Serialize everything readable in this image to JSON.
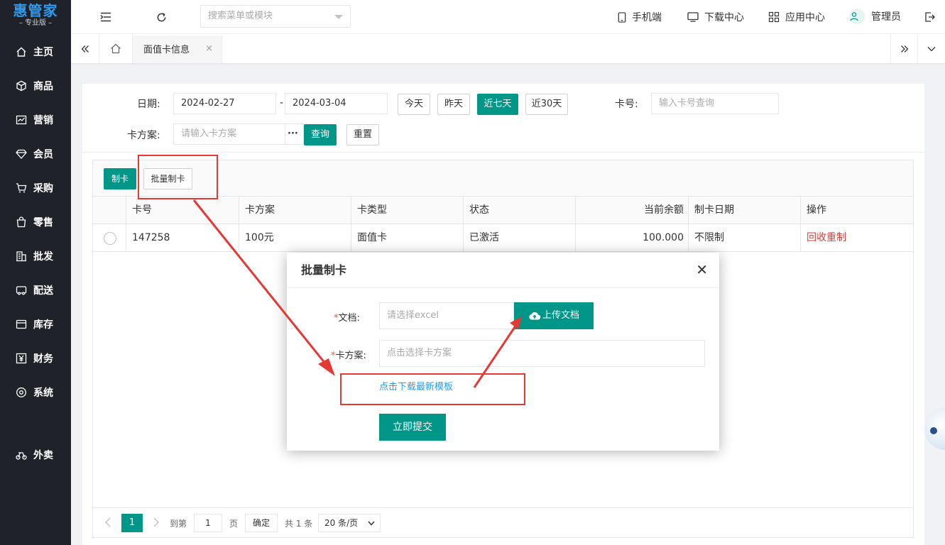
{
  "sidebar": {
    "logo": "惠管家",
    "logo_sub": "– 专业版 –",
    "items": [
      {
        "label": "主页",
        "icon": "home-icon"
      },
      {
        "label": "商品",
        "icon": "box-icon"
      },
      {
        "label": "营销",
        "icon": "chart-icon"
      },
      {
        "label": "会员",
        "icon": "diamond-icon"
      },
      {
        "label": "采购",
        "icon": "cart-icon"
      },
      {
        "label": "零售",
        "icon": "bag-icon"
      },
      {
        "label": "批发",
        "icon": "building-icon"
      },
      {
        "label": "配送",
        "icon": "truck-icon"
      },
      {
        "label": "库存",
        "icon": "inventory-icon"
      },
      {
        "label": "财务",
        "icon": "yen-icon"
      },
      {
        "label": "系统",
        "icon": "settings-icon"
      },
      {
        "label": "外卖",
        "icon": "bike-icon"
      }
    ]
  },
  "header": {
    "search_placeholder": "搜索菜单或模块",
    "mobile": "手机端",
    "download": "下载中心",
    "apps": "应用中心",
    "user": "管理员"
  },
  "tabs": {
    "active": "面值卡信息"
  },
  "filters": {
    "date_label": "日期:",
    "date_from": "2024-02-27",
    "dash": "-",
    "date_to": "2024-03-04",
    "today": "今天",
    "yesterday": "昨天",
    "last7": "近七天",
    "last30": "近30天",
    "card_no_label": "卡号:",
    "card_no_placeholder": "输入卡号查询",
    "plan_label": "卡方案:",
    "plan_placeholder": "请输入卡方案",
    "more": "···",
    "query": "查询",
    "reset": "重置"
  },
  "toolbar": {
    "make_card": "制卡",
    "batch_make": "批量制卡"
  },
  "table": {
    "columns": [
      "卡号",
      "卡方案",
      "卡类型",
      "状态",
      "当前余额",
      "制卡日期",
      "操作"
    ],
    "rows": [
      {
        "card_no": "147258",
        "plan": "100元",
        "type": "面值卡",
        "status": "已激活",
        "balance": "100.000",
        "date": "不限制",
        "action": "回收重制"
      }
    ]
  },
  "pager": {
    "page": "1",
    "goto_label": "到第",
    "goto_value": "1",
    "page_unit": "页",
    "confirm": "确定",
    "total": "共 1 条",
    "page_size": "20 条/页"
  },
  "modal": {
    "title": "批量制卡",
    "doc_label": "文档:",
    "doc_placeholder": "请选择excel",
    "upload": "上传文档",
    "plan_label": "卡方案:",
    "plan_placeholder": "点击选择卡方案",
    "download_template": "点击下载最新模板",
    "submit": "立即提交"
  },
  "colors": {
    "primary": "#009688",
    "sidebar_bg": "#20222a",
    "annotation": "#e53935",
    "link": "#1e9fff",
    "danger": "#e53935"
  }
}
